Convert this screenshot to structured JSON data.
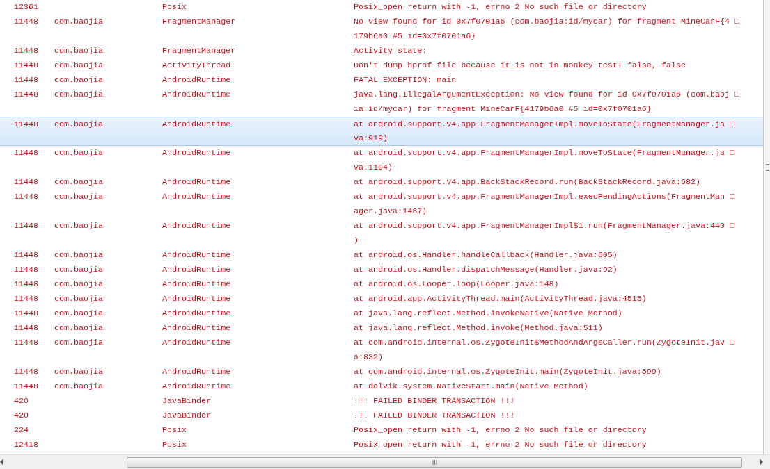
{
  "log": {
    "rows": [
      {
        "pid": "12361",
        "app": "",
        "tag": "Posix",
        "lines": [
          "Posix_open return with -1, errno 2 No such file or directory"
        ],
        "selected": false
      },
      {
        "pid": "11448",
        "app": "com.baojia",
        "tag": "FragmentManager",
        "lines": [
          "No view found for id 0x7f0701a6 (com.baojia:id/mycar) for fragment MineCarF{4 □",
          "179b6a0 #5 id=0x7f0701a6}"
        ],
        "selected": false
      },
      {
        "pid": "11448",
        "app": "com.baojia",
        "tag": "FragmentManager",
        "lines": [
          "Activity state:"
        ],
        "selected": false
      },
      {
        "pid": "11448",
        "app": "com.baojia",
        "tag": "ActivityThread",
        "lines": [
          "Don't dump hprof file because it is not in monkey test! false, false"
        ],
        "selected": false
      },
      {
        "pid": "11448",
        "app": "com.baojia",
        "tag": "AndroidRuntime",
        "lines": [
          "FATAL EXCEPTION: main"
        ],
        "selected": false
      },
      {
        "pid": "11448",
        "app": "com.baojia",
        "tag": "AndroidRuntime",
        "lines": [
          "java.lang.IllegalArgumentException: No view found for id 0x7f0701a6 (com.baoj □",
          "ia:id/mycar) for fragment MineCarF{4179b6a0 #5 id=0x7f0701a6}"
        ],
        "selected": false
      },
      {
        "pid": "11448",
        "app": "com.baojia",
        "tag": "AndroidRuntime",
        "lines": [
          "at android.support.v4.app.FragmentManagerImpl.moveToState(FragmentManager.ja □",
          "va:919)"
        ],
        "selected": true
      },
      {
        "pid": "11448",
        "app": "com.baojia",
        "tag": "AndroidRuntime",
        "lines": [
          "at android.support.v4.app.FragmentManagerImpl.moveToState(FragmentManager.ja □",
          "va:1104)"
        ],
        "selected": false
      },
      {
        "pid": "11448",
        "app": "com.baojia",
        "tag": "AndroidRuntime",
        "lines": [
          "at android.support.v4.app.BackStackRecord.run(BackStackRecord.java:682)"
        ],
        "selected": false
      },
      {
        "pid": "11448",
        "app": "com.baojia",
        "tag": "AndroidRuntime",
        "lines": [
          "at android.support.v4.app.FragmentManagerImpl.execPendingActions(FragmentMan □",
          "ager.java:1467)"
        ],
        "selected": false
      },
      {
        "pid": "11448",
        "app": "com.baojia",
        "tag": "AndroidRuntime",
        "lines": [
          "at android.support.v4.app.FragmentManagerImpl$1.run(FragmentManager.java:440 □",
          ")"
        ],
        "selected": false
      },
      {
        "pid": "11448",
        "app": "com.baojia",
        "tag": "AndroidRuntime",
        "lines": [
          "at android.os.Handler.handleCallback(Handler.java:605)"
        ],
        "selected": false
      },
      {
        "pid": "11448",
        "app": "com.baojia",
        "tag": "AndroidRuntime",
        "lines": [
          "at android.os.Handler.dispatchMessage(Handler.java:92)"
        ],
        "selected": false
      },
      {
        "pid": "11448",
        "app": "com.baojia",
        "tag": "AndroidRuntime",
        "lines": [
          "at android.os.Looper.loop(Looper.java:148)"
        ],
        "selected": false
      },
      {
        "pid": "11448",
        "app": "com.baojia",
        "tag": "AndroidRuntime",
        "lines": [
          "at android.app.ActivityThread.main(ActivityThread.java:4515)"
        ],
        "selected": false
      },
      {
        "pid": "11448",
        "app": "com.baojia",
        "tag": "AndroidRuntime",
        "lines": [
          "at java.lang.reflect.Method.invokeNative(Native Method)"
        ],
        "selected": false
      },
      {
        "pid": "11448",
        "app": "com.baojia",
        "tag": "AndroidRuntime",
        "lines": [
          "at java.lang.reflect.Method.invoke(Method.java:511)"
        ],
        "selected": false
      },
      {
        "pid": "11448",
        "app": "com.baojia",
        "tag": "AndroidRuntime",
        "lines": [
          "at com.android.internal.os.ZygoteInit$MethodAndArgsCaller.run(ZygoteInit.jav □",
          "a:832)"
        ],
        "selected": false
      },
      {
        "pid": "11448",
        "app": "com.baojia",
        "tag": "AndroidRuntime",
        "lines": [
          "at com.android.internal.os.ZygoteInit.main(ZygoteInit.java:599)"
        ],
        "selected": false
      },
      {
        "pid": "11448",
        "app": "com.baojia",
        "tag": "AndroidRuntime",
        "lines": [
          "at dalvik.system.NativeStart.main(Native Method)"
        ],
        "selected": false
      },
      {
        "pid": "420",
        "app": "",
        "tag": "JavaBinder",
        "lines": [
          "!!! FAILED BINDER TRANSACTION !!!"
        ],
        "selected": false
      },
      {
        "pid": "420",
        "app": "",
        "tag": "JavaBinder",
        "lines": [
          "!!! FAILED BINDER TRANSACTION !!!"
        ],
        "selected": false
      },
      {
        "pid": "224",
        "app": "",
        "tag": "Posix",
        "lines": [
          "Posix_open return with -1, errno 2 No such file or directory"
        ],
        "selected": false
      },
      {
        "pid": "12418",
        "app": "",
        "tag": "Posix",
        "lines": [
          "Posix_open return with -1, errno 2 No such file or directory"
        ],
        "selected": false
      }
    ]
  }
}
